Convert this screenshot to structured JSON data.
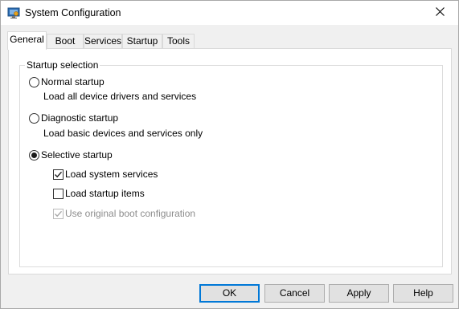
{
  "window": {
    "title": "System Configuration",
    "icon": "msconfig-icon",
    "close_glyph": "✕"
  },
  "tabs": [
    {
      "label": "General",
      "active": true
    },
    {
      "label": "Boot",
      "active": false
    },
    {
      "label": "Services",
      "active": false
    },
    {
      "label": "Startup",
      "active": false
    },
    {
      "label": "Tools",
      "active": false
    }
  ],
  "startup_selection": {
    "legend": "Startup selection",
    "normal": {
      "label": "Normal startup",
      "description": "Load all device drivers and services",
      "checked": false
    },
    "diagnostic": {
      "label": "Diagnostic startup",
      "description": "Load basic devices and services only",
      "checked": false
    },
    "selective": {
      "label": "Selective startup",
      "checked": true
    },
    "options": {
      "load_system_services": {
        "label": "Load system services",
        "checked": true,
        "enabled": true
      },
      "load_startup_items": {
        "label": "Load startup items",
        "checked": false,
        "enabled": true
      },
      "use_original_boot_config": {
        "label": "Use original boot configuration",
        "checked": true,
        "enabled": false
      }
    }
  },
  "buttons": {
    "ok": "OK",
    "cancel": "Cancel",
    "apply": "Apply",
    "help": "Help"
  },
  "colors": {
    "accent": "#0078d7",
    "disabled_text": "#8d8d8d"
  }
}
